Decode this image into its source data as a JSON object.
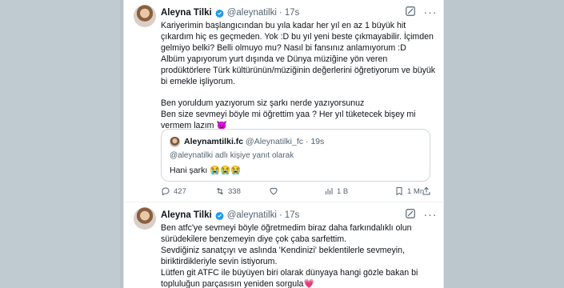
{
  "tweets": [
    {
      "name": "Aleyna Tilki",
      "handle": "@aleynatilki",
      "separator": "·",
      "time": "17s",
      "paragraphs": [
        "Kariyerimin başlangıcından bu yıla kadar her yıl en az 1 büyük hit çıkardım hiç es geçmeden. Yok :D bu yıl yeni beste çıkmayabilir. İçimden gelmiyo belki?  Belli olmuyo mu? Nasıl bi fansınız anlamıyorum :D\nAlbüm yapıyorum yurt dışında ve Dünya müziğine yön veren prodüktörlere Türk kültürünün/müziğinin değerlerini öğretiyorum ve büyük bi emekle işliyorum.",
        "Ben yoruldum yazıyorum siz şarkı nerde yazıyorsunuz\nBen size  sevmeyi böyle mi öğrettim  yaa ? Her yıl tüketecek bişey mi vermem lazım 😈"
      ],
      "quote": {
        "name": "Aleynamtilki.fc",
        "handle": "@Aleynatilki_fc",
        "separator": "·",
        "time": "19s",
        "reply_to": "@aleynatilki adlı kişiye yanıt olarak",
        "text": "Hani şarkı 😭😭😭"
      },
      "stats": {
        "replies": "427",
        "retweets": "338",
        "likes": "",
        "views": "1 B",
        "bookmarks": "1 Mn",
        "share": ""
      }
    },
    {
      "name": "Aleyna Tilki",
      "handle": "@aleynatilki",
      "separator": "·",
      "time": "17s",
      "paragraphs": [
        "Ben atfc'ye sevmeyi böyle öğretmedim biraz daha farkındalıklı  olun sürüdekilere benzemeyin diye çok çaba sarfettim.\nSevdiğiniz sanatçıyı ve aslında 'Kendinizi' beklentilerle sevmeyin, biriktirdikleriyle sevin  istiyorum.\nLütfen git ATFC ile büyüyen biri olarak dünyaya hangi gözle bakan bi topluluğun parçasısın yeniden sorgula💗"
      ]
    }
  ],
  "icons": {
    "grok": "grok-icon",
    "more": "more-icon",
    "verified": "verified-badge-icon",
    "verified_color": "#1d9bf0"
  }
}
